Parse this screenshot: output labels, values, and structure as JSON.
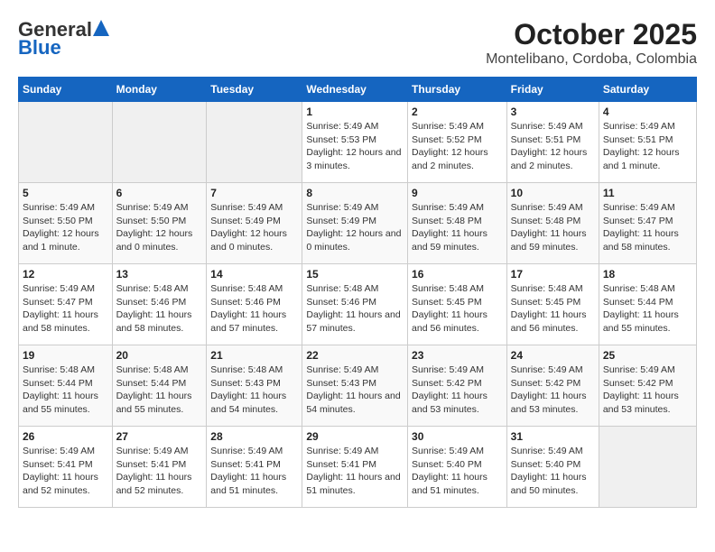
{
  "header": {
    "logo_line1": "General",
    "logo_line2": "Blue",
    "title": "October 2025",
    "subtitle": "Montelibano, Cordoba, Colombia"
  },
  "weekdays": [
    "Sunday",
    "Monday",
    "Tuesday",
    "Wednesday",
    "Thursday",
    "Friday",
    "Saturday"
  ],
  "weeks": [
    [
      {
        "day": "",
        "empty": true
      },
      {
        "day": "",
        "empty": true
      },
      {
        "day": "",
        "empty": true
      },
      {
        "day": "1",
        "sunrise": "Sunrise: 5:49 AM",
        "sunset": "Sunset: 5:53 PM",
        "daylight": "Daylight: 12 hours and 3 minutes."
      },
      {
        "day": "2",
        "sunrise": "Sunrise: 5:49 AM",
        "sunset": "Sunset: 5:52 PM",
        "daylight": "Daylight: 12 hours and 2 minutes."
      },
      {
        "day": "3",
        "sunrise": "Sunrise: 5:49 AM",
        "sunset": "Sunset: 5:51 PM",
        "daylight": "Daylight: 12 hours and 2 minutes."
      },
      {
        "day": "4",
        "sunrise": "Sunrise: 5:49 AM",
        "sunset": "Sunset: 5:51 PM",
        "daylight": "Daylight: 12 hours and 1 minute."
      }
    ],
    [
      {
        "day": "5",
        "sunrise": "Sunrise: 5:49 AM",
        "sunset": "Sunset: 5:50 PM",
        "daylight": "Daylight: 12 hours and 1 minute."
      },
      {
        "day": "6",
        "sunrise": "Sunrise: 5:49 AM",
        "sunset": "Sunset: 5:50 PM",
        "daylight": "Daylight: 12 hours and 0 minutes."
      },
      {
        "day": "7",
        "sunrise": "Sunrise: 5:49 AM",
        "sunset": "Sunset: 5:49 PM",
        "daylight": "Daylight: 12 hours and 0 minutes."
      },
      {
        "day": "8",
        "sunrise": "Sunrise: 5:49 AM",
        "sunset": "Sunset: 5:49 PM",
        "daylight": "Daylight: 12 hours and 0 minutes."
      },
      {
        "day": "9",
        "sunrise": "Sunrise: 5:49 AM",
        "sunset": "Sunset: 5:48 PM",
        "daylight": "Daylight: 11 hours and 59 minutes."
      },
      {
        "day": "10",
        "sunrise": "Sunrise: 5:49 AM",
        "sunset": "Sunset: 5:48 PM",
        "daylight": "Daylight: 11 hours and 59 minutes."
      },
      {
        "day": "11",
        "sunrise": "Sunrise: 5:49 AM",
        "sunset": "Sunset: 5:47 PM",
        "daylight": "Daylight: 11 hours and 58 minutes."
      }
    ],
    [
      {
        "day": "12",
        "sunrise": "Sunrise: 5:49 AM",
        "sunset": "Sunset: 5:47 PM",
        "daylight": "Daylight: 11 hours and 58 minutes."
      },
      {
        "day": "13",
        "sunrise": "Sunrise: 5:48 AM",
        "sunset": "Sunset: 5:46 PM",
        "daylight": "Daylight: 11 hours and 58 minutes."
      },
      {
        "day": "14",
        "sunrise": "Sunrise: 5:48 AM",
        "sunset": "Sunset: 5:46 PM",
        "daylight": "Daylight: 11 hours and 57 minutes."
      },
      {
        "day": "15",
        "sunrise": "Sunrise: 5:48 AM",
        "sunset": "Sunset: 5:46 PM",
        "daylight": "Daylight: 11 hours and 57 minutes."
      },
      {
        "day": "16",
        "sunrise": "Sunrise: 5:48 AM",
        "sunset": "Sunset: 5:45 PM",
        "daylight": "Daylight: 11 hours and 56 minutes."
      },
      {
        "day": "17",
        "sunrise": "Sunrise: 5:48 AM",
        "sunset": "Sunset: 5:45 PM",
        "daylight": "Daylight: 11 hours and 56 minutes."
      },
      {
        "day": "18",
        "sunrise": "Sunrise: 5:48 AM",
        "sunset": "Sunset: 5:44 PM",
        "daylight": "Daylight: 11 hours and 55 minutes."
      }
    ],
    [
      {
        "day": "19",
        "sunrise": "Sunrise: 5:48 AM",
        "sunset": "Sunset: 5:44 PM",
        "daylight": "Daylight: 11 hours and 55 minutes."
      },
      {
        "day": "20",
        "sunrise": "Sunrise: 5:48 AM",
        "sunset": "Sunset: 5:44 PM",
        "daylight": "Daylight: 11 hours and 55 minutes."
      },
      {
        "day": "21",
        "sunrise": "Sunrise: 5:48 AM",
        "sunset": "Sunset: 5:43 PM",
        "daylight": "Daylight: 11 hours and 54 minutes."
      },
      {
        "day": "22",
        "sunrise": "Sunrise: 5:49 AM",
        "sunset": "Sunset: 5:43 PM",
        "daylight": "Daylight: 11 hours and 54 minutes."
      },
      {
        "day": "23",
        "sunrise": "Sunrise: 5:49 AM",
        "sunset": "Sunset: 5:42 PM",
        "daylight": "Daylight: 11 hours and 53 minutes."
      },
      {
        "day": "24",
        "sunrise": "Sunrise: 5:49 AM",
        "sunset": "Sunset: 5:42 PM",
        "daylight": "Daylight: 11 hours and 53 minutes."
      },
      {
        "day": "25",
        "sunrise": "Sunrise: 5:49 AM",
        "sunset": "Sunset: 5:42 PM",
        "daylight": "Daylight: 11 hours and 53 minutes."
      }
    ],
    [
      {
        "day": "26",
        "sunrise": "Sunrise: 5:49 AM",
        "sunset": "Sunset: 5:41 PM",
        "daylight": "Daylight: 11 hours and 52 minutes."
      },
      {
        "day": "27",
        "sunrise": "Sunrise: 5:49 AM",
        "sunset": "Sunset: 5:41 PM",
        "daylight": "Daylight: 11 hours and 52 minutes."
      },
      {
        "day": "28",
        "sunrise": "Sunrise: 5:49 AM",
        "sunset": "Sunset: 5:41 PM",
        "daylight": "Daylight: 11 hours and 51 minutes."
      },
      {
        "day": "29",
        "sunrise": "Sunrise: 5:49 AM",
        "sunset": "Sunset: 5:41 PM",
        "daylight": "Daylight: 11 hours and 51 minutes."
      },
      {
        "day": "30",
        "sunrise": "Sunrise: 5:49 AM",
        "sunset": "Sunset: 5:40 PM",
        "daylight": "Daylight: 11 hours and 51 minutes."
      },
      {
        "day": "31",
        "sunrise": "Sunrise: 5:49 AM",
        "sunset": "Sunset: 5:40 PM",
        "daylight": "Daylight: 11 hours and 50 minutes."
      },
      {
        "day": "",
        "empty": true
      }
    ]
  ]
}
